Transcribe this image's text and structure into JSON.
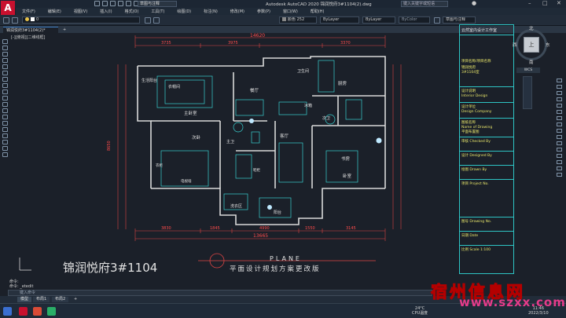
{
  "app": {
    "logo": "A",
    "title": "Autodesk AutoCAD 2020   锦润悦府3#1104(2).dwg",
    "search_placeholder": "键入关键字或短语",
    "workspace": "草图与注释"
  },
  "menu": [
    "文件(F)",
    "编辑(E)",
    "视图(V)",
    "插入(I)",
    "格式(O)",
    "工具(T)",
    "绘图(D)",
    "标注(N)",
    "修改(M)",
    "参数(P)",
    "窗口(W)",
    "帮助(H)"
  ],
  "toolbar": {
    "layer_value": "0",
    "color_value": "颜色 252",
    "linetype_value": "ByLayer",
    "lineweight_value": "ByLayer",
    "plotstyle_value": "ByColor",
    "workspace_combo": "草图与注释"
  },
  "doc_tabs": [
    "锦润悦府3#1104(2)*",
    "+"
  ],
  "viewport_label": "[-][俯视][二维线框]",
  "viewcube": {
    "north": "北",
    "south": "南",
    "west": "西",
    "east": "东",
    "face": "上",
    "wcs": "WCS"
  },
  "drawing": {
    "dim_top_total": "14620",
    "dims_top": [
      "3735",
      "3975",
      "3370"
    ],
    "dims_bottom": [
      "3830",
      "1845",
      "4990",
      "1550",
      "3145"
    ],
    "dim_bottom_total": "13665",
    "dim_left_total": "8650",
    "rooms": [
      "生活阳台",
      "主卧室",
      "衣帽间",
      "厨房",
      "餐厅",
      "卫生间",
      "次卧",
      "主卫",
      "客厅",
      "书房",
      "冰箱",
      "次卫",
      "卧室",
      "洗衣区",
      "阳台",
      "鞋柜",
      "电视墙",
      "衣柜"
    ],
    "project_title": "锦润悦府3#1104",
    "plane_label": "PLANE",
    "plan_subtitle": "平面设计规划方案更改版"
  },
  "title_block": {
    "studio": "云然室内设计工作室",
    "rows": [
      "项目名称/项目名称",
      "锦润悦府",
      "3#1104室",
      "设计说明",
      "Interior Design",
      "设计单位",
      "Design Company",
      "图纸名称",
      "Name of Drawing",
      "平面布置图",
      "审核 Checked By",
      "设计 Designed By",
      "绘图 Drawn By",
      "项目 Project No.",
      "图号 Drawing No.",
      "日期 Date",
      "比例 Scale 1:100"
    ]
  },
  "command": {
    "history": [
      "命令:",
      "命令: _etedit"
    ],
    "input_placeholder": "键入命令"
  },
  "layout_tabs": [
    "模型",
    "布局1",
    "布局2",
    "+"
  ],
  "taskbar": {
    "temp": "24°C",
    "temp_label": "CPU温度",
    "time": "11:46",
    "date": "2022/3/10"
  },
  "watermark": {
    "brand": "宿州信息网",
    "url": "www.szxx.com.cn"
  }
}
